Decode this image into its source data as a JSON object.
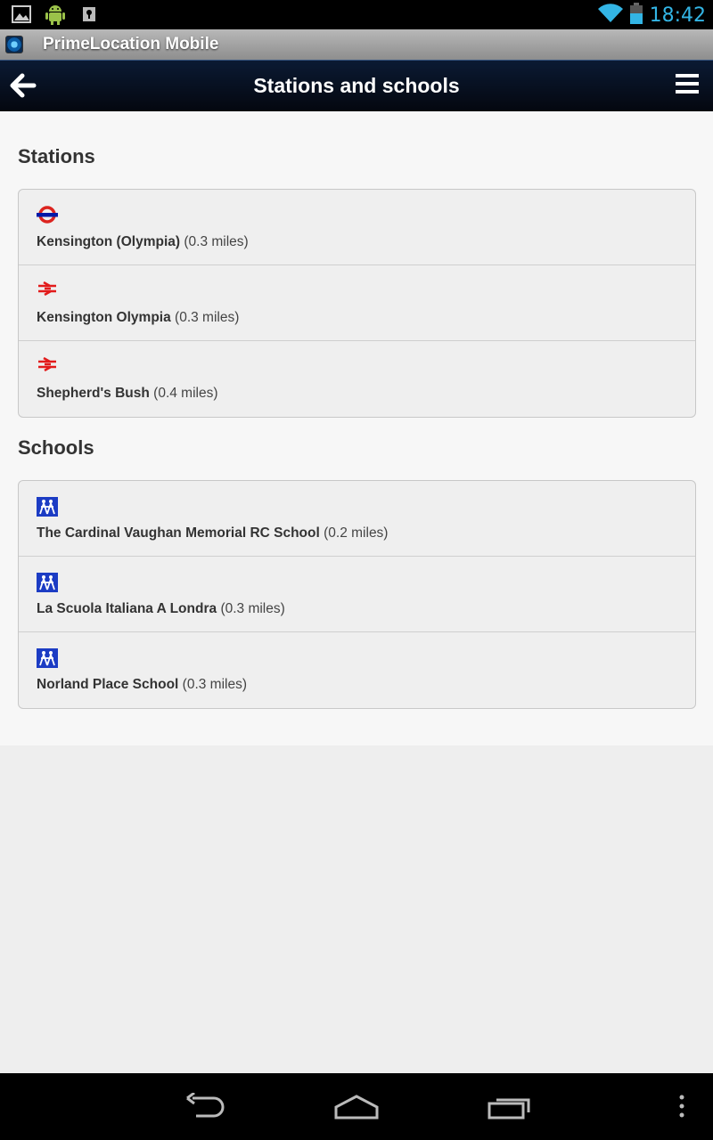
{
  "status_bar": {
    "time": "18:42",
    "icons": [
      "gallery-icon",
      "android-icon",
      "keyhole-icon",
      "wifi-icon",
      "battery-icon"
    ]
  },
  "app_bar": {
    "title": "PrimeLocation Mobile"
  },
  "header": {
    "title": "Stations and schools"
  },
  "stations": {
    "title": "Stations",
    "items": [
      {
        "icon": "underground-icon",
        "name": "Kensington (Olympia)",
        "distance": "(0.3 miles)"
      },
      {
        "icon": "rail-icon",
        "name": "Kensington Olympia",
        "distance": "(0.3 miles)"
      },
      {
        "icon": "rail-icon",
        "name": "Shepherd's Bush",
        "distance": "(0.4 miles)"
      }
    ]
  },
  "schools": {
    "title": "Schools",
    "items": [
      {
        "icon": "school-icon",
        "name": "The Cardinal Vaughan Memorial RC School",
        "distance": "(0.2 miles)"
      },
      {
        "icon": "school-icon",
        "name": "La Scuola Italiana A Londra",
        "distance": "(0.3 miles)"
      },
      {
        "icon": "school-icon",
        "name": "Norland Place School",
        "distance": "(0.3 miles)"
      }
    ]
  },
  "colors": {
    "clock": "#33b5e5",
    "underground_red": "#dc241f",
    "underground_blue": "#0019a8",
    "rail_red": "#e21b1b",
    "school_blue": "#1c3cc4"
  }
}
